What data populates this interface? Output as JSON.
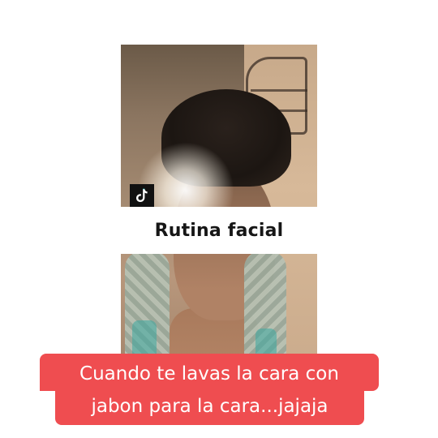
{
  "overlay": {
    "title": "Rutina facial",
    "caption_line_1": "Cuando te lavas la cara con",
    "caption_line_2": "jabon para la cara...jajaja"
  },
  "badge": {
    "icon": "tiktok-logo-icon"
  },
  "colors": {
    "caption_bg": "#ef4d50",
    "caption_text": "#ffffff",
    "title_bg": "#ffffff",
    "title_text": "#161616",
    "badge_bg": "#111111"
  }
}
